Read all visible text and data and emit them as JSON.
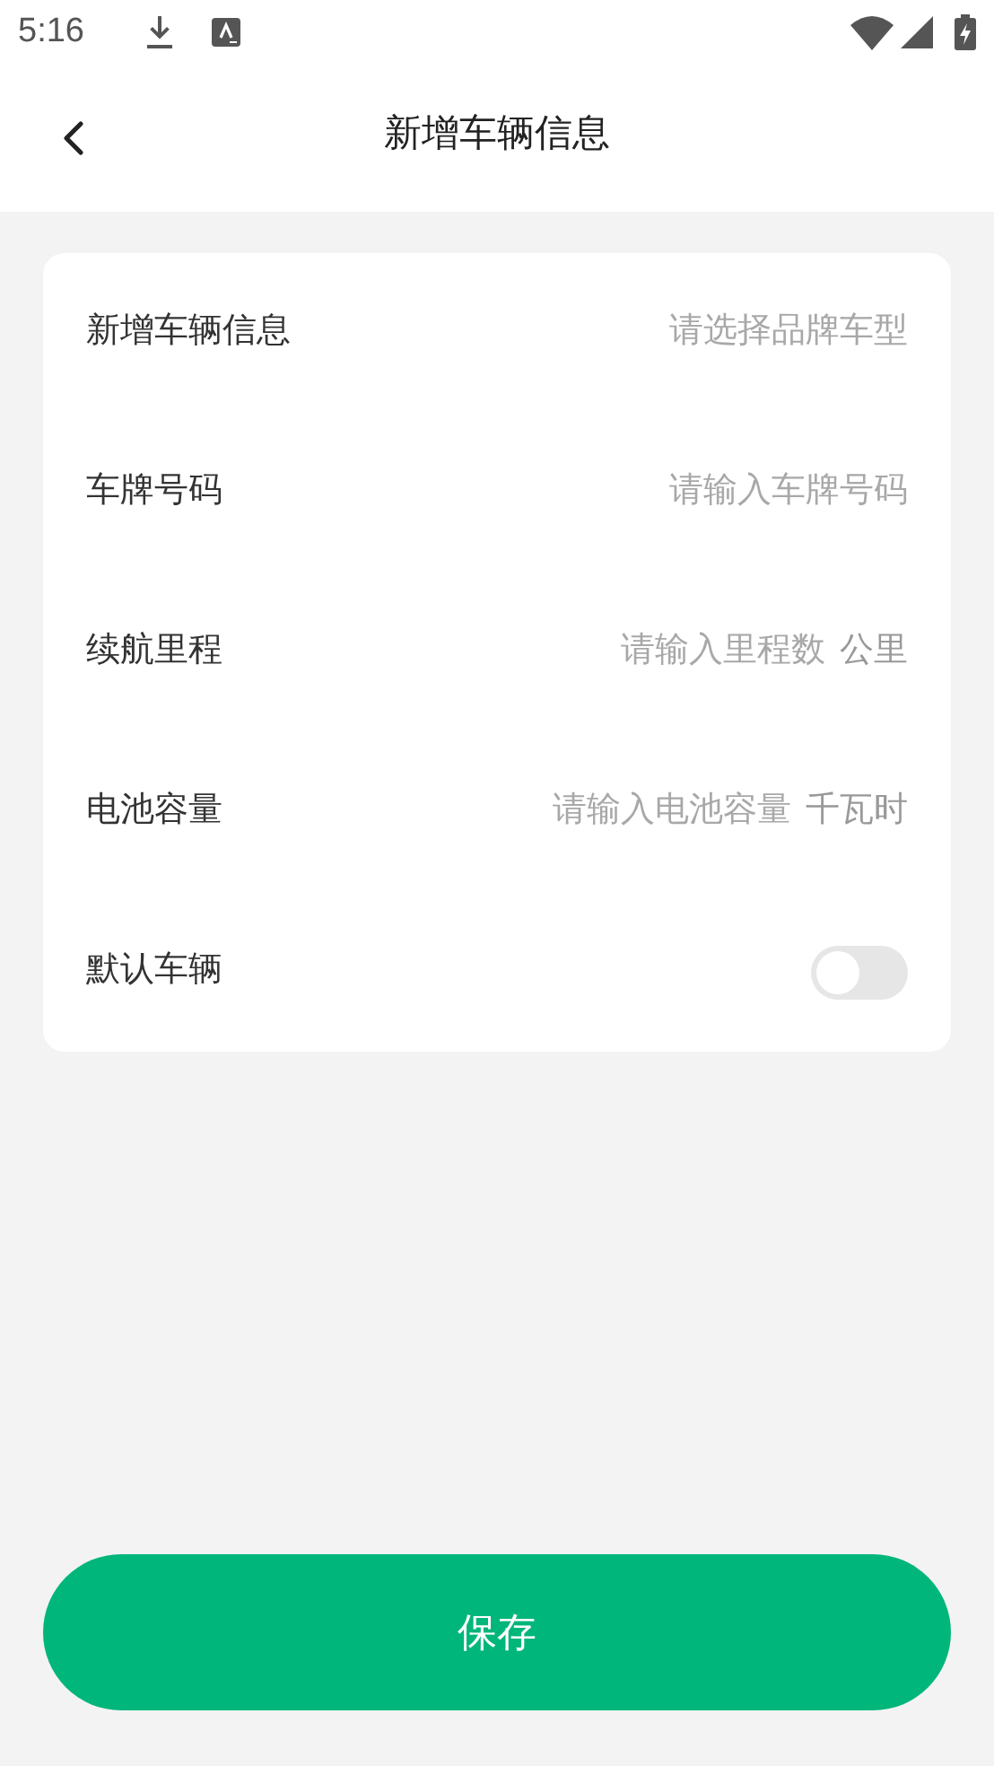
{
  "status_bar": {
    "time": "5:16"
  },
  "header": {
    "title": "新增车辆信息"
  },
  "form": {
    "rows": [
      {
        "kind": "select",
        "label": "新增车辆信息",
        "placeholder": "请选择品牌车型"
      },
      {
        "kind": "input",
        "label": "车牌号码",
        "placeholder": "请输入车牌号码"
      },
      {
        "kind": "input",
        "label": "续航里程",
        "placeholder": "请输入里程数",
        "unit": "公里"
      },
      {
        "kind": "input",
        "label": "电池容量",
        "placeholder": "请输入电池容量",
        "unit": "千瓦时"
      },
      {
        "kind": "toggle",
        "label": "默认车辆",
        "on": false
      }
    ]
  },
  "save_button": {
    "label": "保存"
  }
}
